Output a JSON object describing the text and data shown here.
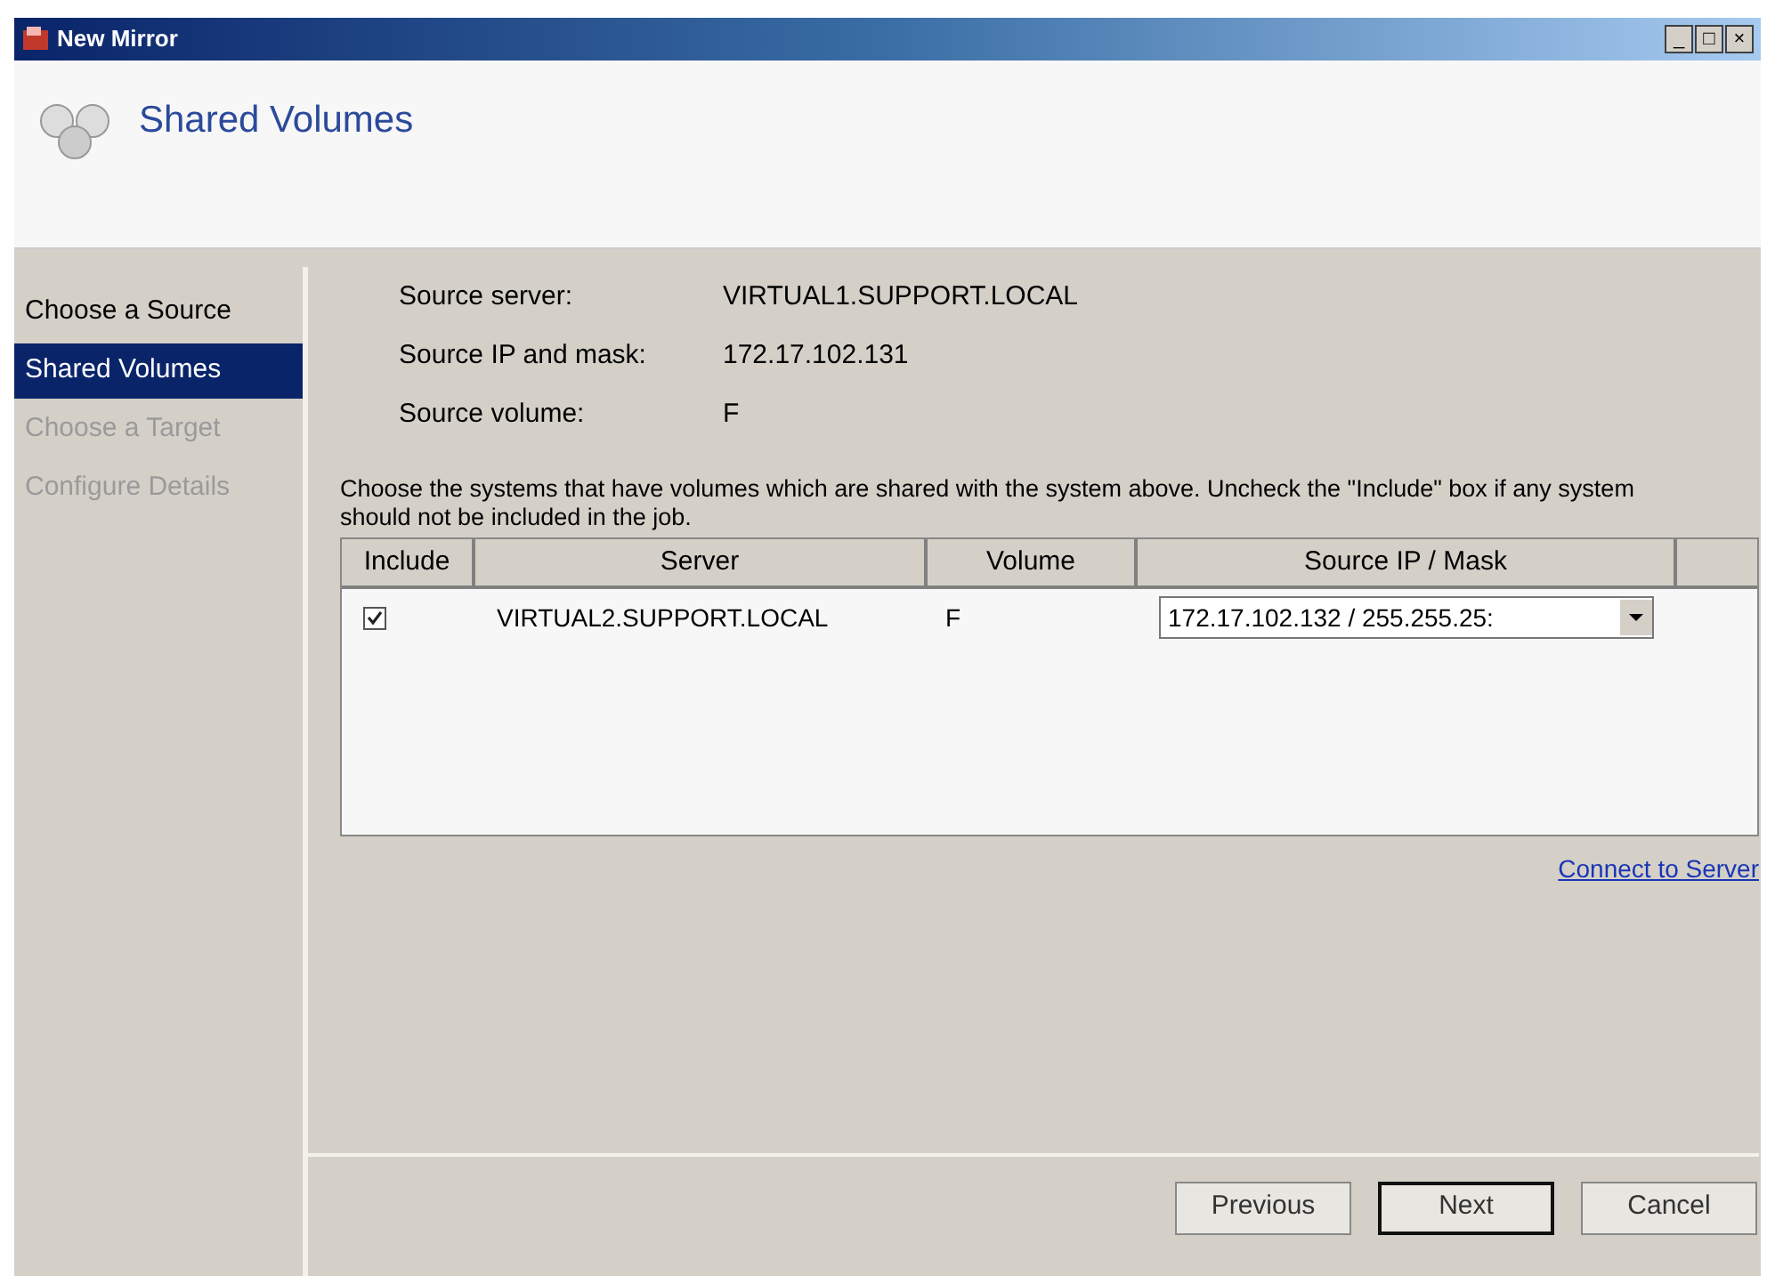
{
  "window": {
    "title": "New Mirror",
    "controls": [
      "_",
      "□",
      "×"
    ]
  },
  "header": {
    "title": "Shared Volumes"
  },
  "steps": [
    {
      "label": "Choose a Source",
      "selected": false,
      "disabled": false
    },
    {
      "label": "Shared Volumes",
      "selected": true,
      "disabled": false
    },
    {
      "label": "Choose a Target",
      "selected": false,
      "disabled": true
    },
    {
      "label": "Configure Details",
      "selected": false,
      "disabled": true
    }
  ],
  "source_info": [
    {
      "label": "Source server:",
      "value": "VIRTUAL1.SUPPORT.LOCAL"
    },
    {
      "label": "Source IP and mask:",
      "value": "172.17.102.131"
    },
    {
      "label": "Source volume:",
      "value": "F"
    }
  ],
  "instructions": "Choose the systems that have volumes which are shared with the system above. Uncheck the \"Include\" box if any system should not be included in the job.",
  "table": {
    "columns": [
      "Include",
      "Server",
      "Volume",
      "Source IP / Mask"
    ],
    "rows": [
      {
        "checked": true,
        "server": "VIRTUAL2.SUPPORT.LOCAL",
        "volume": "F",
        "ip_mask": "172.17.102.132 / 255.255.25:"
      }
    ]
  },
  "link": "Connect to Server",
  "buttons": [
    {
      "label": "Previous",
      "default": false
    },
    {
      "label": "Next",
      "default": true
    },
    {
      "label": "Cancel",
      "default": false
    }
  ]
}
